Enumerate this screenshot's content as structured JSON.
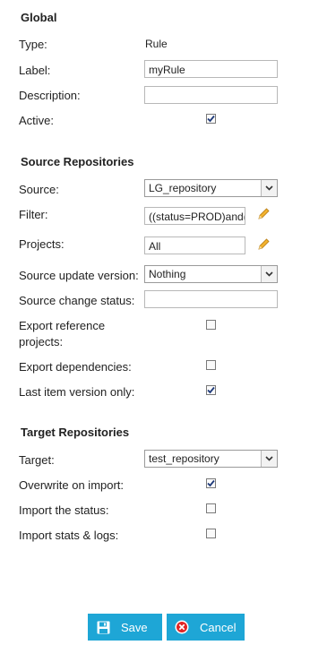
{
  "global": {
    "title": "Global",
    "type_label": "Type:",
    "type_value": "Rule",
    "label_label": "Label:",
    "label_value": "myRule",
    "description_label": "Description:",
    "description_value": "",
    "active_label": "Active:",
    "active_checked": true
  },
  "source": {
    "title": "Source Repositories",
    "source_label": "Source:",
    "source_value": "LG_repository",
    "filter_label": "Filter:",
    "filter_value": "((status=PROD)and(",
    "projects_label": "Projects:",
    "projects_value": "All",
    "update_version_label": "Source update version:",
    "update_version_value": "Nothing",
    "change_status_label": "Source change status:",
    "change_status_value": "",
    "export_ref_label_line1": "Export reference",
    "export_ref_label_line2": "projects:",
    "export_ref_checked": false,
    "export_deps_label": "Export dependencies:",
    "export_deps_checked": false,
    "last_item_label": "Last item version only:",
    "last_item_checked": true
  },
  "target": {
    "title": "Target Repositories",
    "target_label": "Target:",
    "target_value": "test_repository",
    "overwrite_label": "Overwrite on import:",
    "overwrite_checked": true,
    "import_status_label": "Import the status:",
    "import_status_checked": false,
    "import_stats_label": "Import stats & logs:",
    "import_stats_checked": false
  },
  "buttons": {
    "save_label": "Save",
    "cancel_label": "Cancel"
  },
  "icons": {
    "save": "floppy-disk-icon",
    "cancel": "cancel-circle-icon",
    "edit": "pencil-icon",
    "dropdown": "chevron-down-icon",
    "check": "checkmark-icon"
  },
  "colors": {
    "button_bg": "#1ea6d6",
    "check_color": "#1e3a7a",
    "pencil_color": "#e8a317",
    "cancel_icon": "#e02424"
  }
}
